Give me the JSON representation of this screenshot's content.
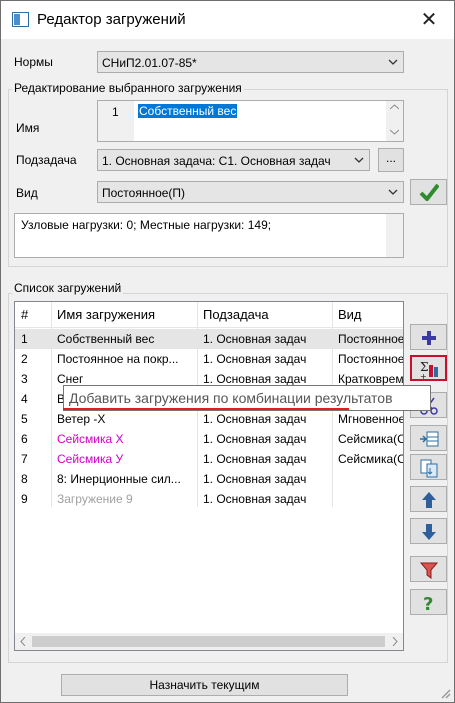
{
  "window": {
    "title": "Редактор загружений"
  },
  "norms": {
    "label": "Нормы",
    "value": "СНиП2.01.07-85*"
  },
  "edit_group": {
    "title": "Редактирование выбранного загружения",
    "name_label": "Имя",
    "name_number": "1",
    "name_value": "Собственный вес",
    "subtask_label": "Подзадача",
    "subtask_value": "1. Основная задача: С1. Основная задач",
    "subtask_more": "...",
    "kind_label": "Вид",
    "kind_value": "Постоянное(П)",
    "loads_info": "Узловые нагрузки:  0;  Местные нагрузки:  149;"
  },
  "list_group": {
    "title": "Список загружений",
    "columns": [
      "#",
      "Имя загружения",
      "Подзадача",
      "Вид"
    ],
    "rows": [
      {
        "num": "1",
        "name": "Собственный вес",
        "subtask": "1. Основная задач",
        "kind": "Постоянное(П)",
        "color": "#000000"
      },
      {
        "num": "2",
        "name": "Постоянное на покр...",
        "subtask": "1. Основная задач",
        "kind": "Постоянное(П)",
        "color": "#000000"
      },
      {
        "num": "3",
        "name": "Снег",
        "subtask": "1. Основная задач",
        "kind": "Кратковременное",
        "color": "#000000"
      },
      {
        "num": "4",
        "name": "В",
        "subtask": "",
        "kind": "",
        "color": "#000000"
      },
      {
        "num": "5",
        "name": "Ветер -X",
        "subtask": "1. Основная задач",
        "kind": "Мгновенное",
        "color": "#000000"
      },
      {
        "num": "6",
        "name": "Сейсмика X",
        "subtask": "1. Основная задач",
        "kind": "Сейсмика(С)",
        "color": "#d000c8"
      },
      {
        "num": "7",
        "name": "Сейсмика У",
        "subtask": "1. Основная задач",
        "kind": "Сейсмика(С)",
        "color": "#d000c8"
      },
      {
        "num": "8",
        "name": "8: Инерционные сил...",
        "subtask": "1. Основная задач",
        "kind": "",
        "color": "#000000"
      },
      {
        "num": "9",
        "name": "Загружение 9",
        "subtask": "1. Основная задач",
        "kind": "",
        "color": "#a0a0a0"
      }
    ]
  },
  "tooltip": "Добавить загружения по комбинации результатов",
  "assign_button": "Назначить текущим",
  "colors": {
    "accent": "#0078d7",
    "highlight_border": "#c8102e",
    "seismic": "#d000c8"
  }
}
